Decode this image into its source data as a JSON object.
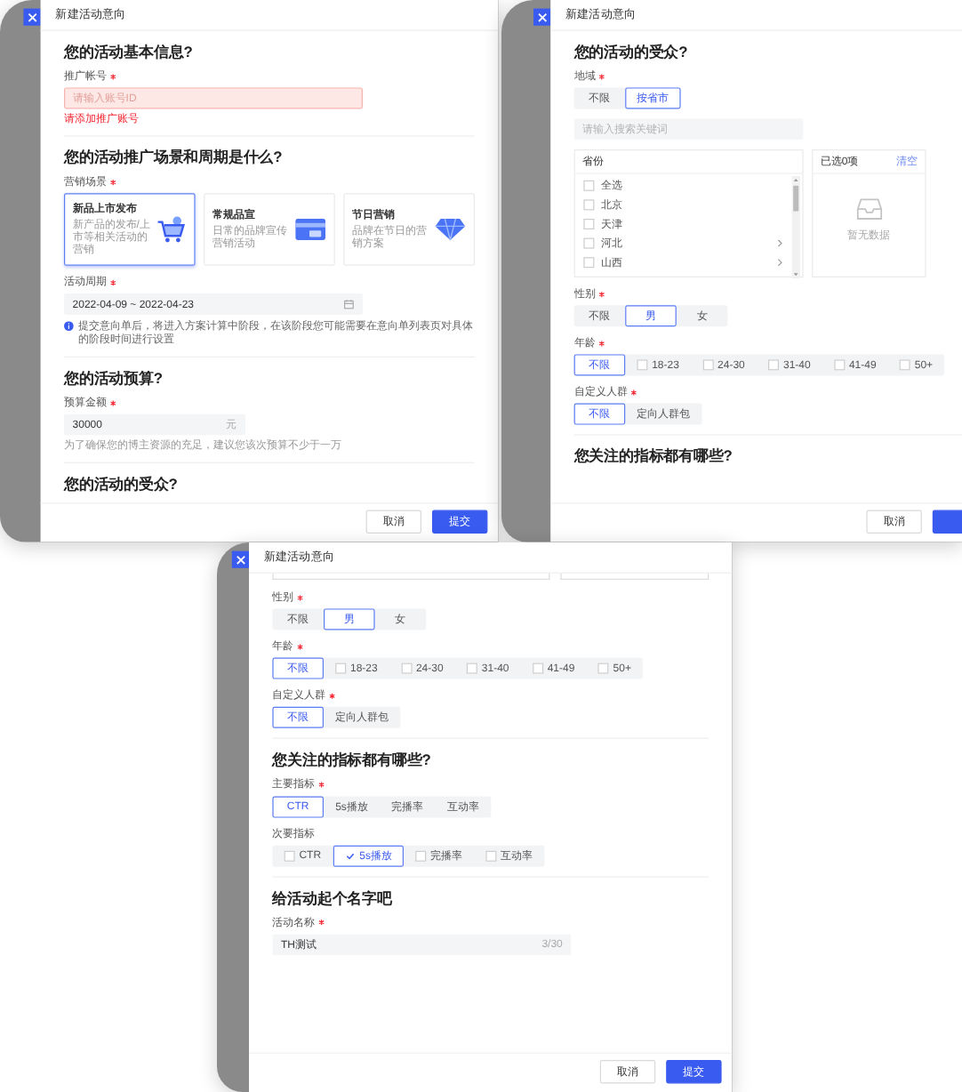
{
  "panels": [
    {
      "title": "新建活动意向",
      "sections": [
        {
          "heading": "您的活动基本信息?",
          "fields": [
            {
              "kind": "input",
              "label": "推广帐号",
              "required": true,
              "placeholder": "请输入账号ID",
              "invalid": true,
              "error": "请添加推广账号"
            }
          ]
        },
        {
          "heading": "您的活动推广场景和周期是什么?",
          "fields": [
            {
              "kind": "cards",
              "label": "营销场景",
              "required": true,
              "options": [
                {
                  "kind": "launch",
                  "title": "新品上市发布",
                  "desc": "新产品的发布/上市等相关活动的营销",
                  "selected": true
                },
                {
                  "kind": "promo",
                  "title": "常规品宣",
                  "desc": "日常的品牌宣传营销活动",
                  "selected": false
                },
                {
                  "kind": "festival",
                  "title": "节日营销",
                  "desc": "品牌在节日的营销方案",
                  "selected": false
                }
              ]
            },
            {
              "kind": "date",
              "label": "活动周期",
              "required": true,
              "value": "2022-04-09 ~ 2022-04-23",
              "info": "提交意向单后，将进入方案计算中阶段，在该阶段您可能需要在意向单列表页对具体的阶段时间进行设置"
            }
          ]
        },
        {
          "heading": "您的活动预算?",
          "fields": [
            {
              "kind": "input",
              "label": "预算金额",
              "required": true,
              "value": "30000",
              "suffix": "元",
              "invalid": false,
              "hint": "为了确保您的博主资源的充足，建议您该次预算不少于一万"
            }
          ]
        },
        {
          "heading": "您的活动的受众?"
        }
      ],
      "buttons": [
        {
          "label": "取消",
          "primary": false
        },
        {
          "label": "提交",
          "primary": true
        }
      ]
    },
    {
      "title": "新建活动意向",
      "sections": [
        {
          "heading": "您的活动的受众?",
          "fields": [
            {
              "kind": "segmented",
              "label": "地域",
              "required": true,
              "options": [
                {
                  "kind": "plain",
                  "label": "不限",
                  "selected": false
                },
                {
                  "kind": "plain",
                  "label": "按省市",
                  "selected": true
                }
              ]
            },
            {
              "kind": "search",
              "placeholder": "请输入搜索关键词"
            },
            {
              "kind": "transfer",
              "list_title": "省份",
              "items": [
                {
                  "label": "全选",
                  "checked": false,
                  "expandable": false
                },
                {
                  "label": "北京",
                  "checked": false,
                  "expandable": false
                },
                {
                  "label": "天津",
                  "checked": false,
                  "expandable": false
                },
                {
                  "label": "河北",
                  "checked": false,
                  "expandable": true
                },
                {
                  "label": "山西",
                  "checked": false,
                  "expandable": true
                }
              ],
              "selected_title": "已选0项",
              "clear": "清空",
              "empty": "暂无数据"
            },
            {
              "kind": "segmented",
              "label": "性别",
              "required": true,
              "options": [
                {
                  "kind": "plain",
                  "label": "不限",
                  "selected": false
                },
                {
                  "kind": "plain",
                  "label": "男",
                  "selected": true
                },
                {
                  "kind": "plain",
                  "label": "女",
                  "selected": false
                }
              ]
            },
            {
              "kind": "segmented",
              "label": "年龄",
              "required": true,
              "options": [
                {
                  "kind": "plain",
                  "label": "不限",
                  "selected": true
                },
                {
                  "kind": "check",
                  "label": "18-23",
                  "selected": false,
                  "checked": false
                },
                {
                  "kind": "check",
                  "label": "24-30",
                  "selected": false,
                  "checked": false
                },
                {
                  "kind": "check",
                  "label": "31-40",
                  "selected": false,
                  "checked": false
                },
                {
                  "kind": "check",
                  "label": "41-49",
                  "selected": false,
                  "checked": false
                },
                {
                  "kind": "check",
                  "label": "50+",
                  "selected": false,
                  "checked": false
                }
              ]
            },
            {
              "kind": "segmented",
              "label": "自定义人群",
              "required": true,
              "options": [
                {
                  "kind": "plain",
                  "label": "不限",
                  "selected": true
                },
                {
                  "kind": "plain",
                  "label": "定向人群包",
                  "selected": false
                }
              ]
            }
          ]
        },
        {
          "heading": "您关注的指标都有哪些?"
        }
      ],
      "buttons": [
        {
          "label": "取消",
          "primary": false
        },
        {
          "primary": true
        }
      ]
    },
    {
      "title": "新建活动意向",
      "top_cut": true,
      "sections": [
        {
          "fields": [
            {
              "kind": "segmented",
              "label": "性别",
              "required": true,
              "options": [
                {
                  "kind": "plain",
                  "label": "不限",
                  "selected": false
                },
                {
                  "kind": "plain",
                  "label": "男",
                  "selected": true
                },
                {
                  "kind": "plain",
                  "label": "女",
                  "selected": false
                }
              ]
            },
            {
              "kind": "segmented",
              "label": "年龄",
              "required": true,
              "options": [
                {
                  "kind": "plain",
                  "label": "不限",
                  "selected": true
                },
                {
                  "kind": "check",
                  "label": "18-23",
                  "selected": false,
                  "checked": false
                },
                {
                  "kind": "check",
                  "label": "24-30",
                  "selected": false,
                  "checked": false
                },
                {
                  "kind": "check",
                  "label": "31-40",
                  "selected": false,
                  "checked": false
                },
                {
                  "kind": "check",
                  "label": "41-49",
                  "selected": false,
                  "checked": false
                },
                {
                  "kind": "check",
                  "label": "50+",
                  "selected": false,
                  "checked": false
                }
              ]
            },
            {
              "kind": "segmented",
              "label": "自定义人群",
              "required": true,
              "options": [
                {
                  "kind": "plain",
                  "label": "不限",
                  "selected": true
                },
                {
                  "kind": "plain",
                  "label": "定向人群包",
                  "selected": false
                }
              ]
            }
          ]
        },
        {
          "heading": "您关注的指标都有哪些?",
          "fields": [
            {
              "kind": "segmented",
              "label": "主要指标",
              "required": true,
              "options": [
                {
                  "kind": "plain",
                  "label": "CTR",
                  "selected": true
                },
                {
                  "kind": "plain",
                  "label": "5s播放",
                  "selected": false
                },
                {
                  "kind": "plain",
                  "label": "完播率",
                  "selected": false
                },
                {
                  "kind": "plain",
                  "label": "互动率",
                  "selected": false
                }
              ]
            },
            {
              "kind": "segmented",
              "label": "次要指标",
              "required": false,
              "options": [
                {
                  "kind": "check",
                  "label": "CTR",
                  "selected": false,
                  "checked": false
                },
                {
                  "kind": "check",
                  "label": "5s播放",
                  "selected": true,
                  "checked": true
                },
                {
                  "kind": "check",
                  "label": "完播率",
                  "selected": false,
                  "checked": false
                },
                {
                  "kind": "check",
                  "label": "互动率",
                  "selected": false,
                  "checked": false
                }
              ]
            }
          ]
        },
        {
          "heading": "给活动起个名字吧",
          "fields": [
            {
              "kind": "input",
              "label": "活动名称",
              "required": true,
              "value": "TH测试",
              "suffix": "3/30",
              "invalid": false
            }
          ]
        }
      ],
      "buttons": [
        {
          "label": "取消",
          "primary": false
        },
        {
          "label": "提交",
          "primary": true
        }
      ]
    }
  ]
}
